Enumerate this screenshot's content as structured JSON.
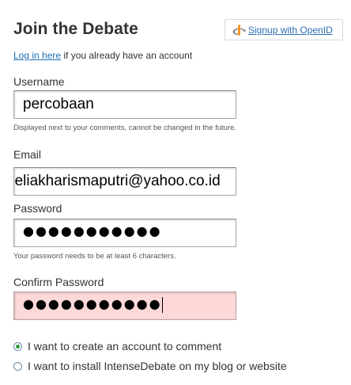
{
  "form": {
    "title": "Join the Debate",
    "openid": {
      "label": "Signup with OpenID",
      "icon": "openid-icon"
    },
    "login": {
      "link_text": "Log in here",
      "suffix": " if you already have an account"
    },
    "username": {
      "label": "Username",
      "value": "percobaan",
      "hint": "Displayed next to your comments, cannot be changed in the future."
    },
    "email": {
      "label": "Email",
      "value": "neliakharismaputri@yahoo.co.id"
    },
    "password": {
      "label": "Password",
      "value": "●●●●●●●●●●●",
      "hint": "Your password needs to be at least 6 characters."
    },
    "confirm_password": {
      "label": "Confirm Password",
      "value": "●●●●●●●●●●●",
      "state": "error"
    },
    "account_options": [
      {
        "label": "I want to create an account to comment",
        "checked": true
      },
      {
        "label": "I want to install IntenseDebate on my blog or website",
        "checked": false
      }
    ]
  },
  "colors": {
    "link": "#1d6dae",
    "openid_orange": "#f7931e",
    "error_field_bg": "#fcd8d8",
    "radio_selected": "#2f9a3a"
  }
}
